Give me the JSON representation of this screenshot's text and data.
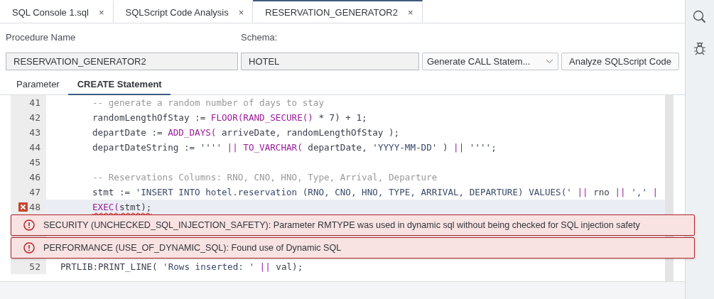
{
  "tabs": [
    {
      "label": "SQL Console 1.sql",
      "close": "×",
      "selected": false
    },
    {
      "label": "SQLScript Code Analysis",
      "close": "×",
      "selected": false
    },
    {
      "label": "RESERVATION_GENERATOR2",
      "close": "×",
      "selected": true
    }
  ],
  "form": {
    "procedure_label": "Procedure Name",
    "procedure_value": "RESERVATION_GENERATOR2",
    "schema_label": "Schema:",
    "schema_value": "HOTEL",
    "generate_select": "Generate CALL Statem...",
    "analyze_button": "Analyze SQLScript Code"
  },
  "subtabs": [
    {
      "label": "Parameter",
      "selected": false
    },
    {
      "label": "CREATE Statement",
      "selected": true
    }
  ],
  "editor": {
    "lines": [
      {
        "number": "41",
        "indent": true,
        "error": false,
        "current": false,
        "segments": [
          {
            "kind": "comment",
            "text": "-- generate a random number of days to stay"
          }
        ]
      },
      {
        "number": "42",
        "indent": true,
        "error": false,
        "current": false,
        "segments": [
          {
            "kind": "plain",
            "text": "randomLengthOfStay := "
          },
          {
            "kind": "keyword",
            "text": "FLOOR(RAND_SECURE()"
          },
          {
            "kind": "plain",
            "text": " * 7) + 1;"
          }
        ]
      },
      {
        "number": "43",
        "indent": true,
        "error": false,
        "current": false,
        "segments": [
          {
            "kind": "plain",
            "text": "departDate := "
          },
          {
            "kind": "keyword",
            "text": "ADD_DAYS("
          },
          {
            "kind": "plain",
            "text": " arriveDate, randomLengthOfStay );"
          }
        ]
      },
      {
        "number": "44",
        "indent": true,
        "error": false,
        "current": false,
        "segments": [
          {
            "kind": "plain",
            "text": "departDateString := "
          },
          {
            "kind": "string",
            "text": "'''' "
          },
          {
            "kind": "keyword",
            "text": "|| TO_VARCHAR("
          },
          {
            "kind": "plain",
            "text": " departDate, "
          },
          {
            "kind": "string",
            "text": "'YYYY-MM-DD'"
          },
          {
            "kind": "plain",
            "text": " ) "
          },
          {
            "kind": "keyword",
            "text": "|| "
          },
          {
            "kind": "string",
            "text": "''''"
          },
          {
            "kind": "plain",
            "text": ";"
          }
        ]
      },
      {
        "number": "45",
        "indent": true,
        "error": false,
        "current": false
      },
      {
        "number": "46",
        "indent": true,
        "error": false,
        "current": false,
        "segments": [
          {
            "kind": "comment",
            "text": "-- Reservations Columns: RNO, CNO, HNO, Type, Arrival, Departure"
          }
        ]
      },
      {
        "number": "47",
        "indent": true,
        "error": false,
        "current": false,
        "segments": [
          {
            "kind": "plain",
            "text": "stmt := "
          },
          {
            "kind": "string",
            "text": "'INSERT INTO hotel.reservation (RNO, CNO, HNO, TYPE, ARRIVAL, DEPARTURE) VALUES(' "
          },
          {
            "kind": "keyword",
            "text": "||"
          },
          {
            "kind": "plain",
            "text": " rno "
          },
          {
            "kind": "keyword",
            "text": "|| "
          },
          {
            "kind": "string",
            "text": "',' "
          },
          {
            "kind": "keyword",
            "text": "|"
          }
        ]
      },
      {
        "number": "48",
        "indent": true,
        "error": true,
        "current": true,
        "segments": [
          {
            "kind": "keyword",
            "text": "EXEC("
          },
          {
            "kind": "plain",
            "text": "stmt);"
          }
        ]
      },
      {
        "number": "52",
        "indent": false,
        "error": false,
        "current": false,
        "segments": [
          {
            "kind": "plain",
            "text": "PRTLIB:PRINT_LINE( "
          },
          {
            "kind": "string",
            "text": "'Rows inserted: ' "
          },
          {
            "kind": "keyword",
            "text": "||"
          },
          {
            "kind": "plain",
            "text": " val);"
          }
        ]
      }
    ]
  },
  "messages": [
    "SECURITY (UNCHECKED_SQL_INJECTION_SAFETY): Parameter RMTYPE was used in dynamic sql without being checked for SQL injection safety",
    "PERFORMANCE (USE_OF_DYNAMIC_SQL): Found use of Dynamic SQL"
  ]
}
